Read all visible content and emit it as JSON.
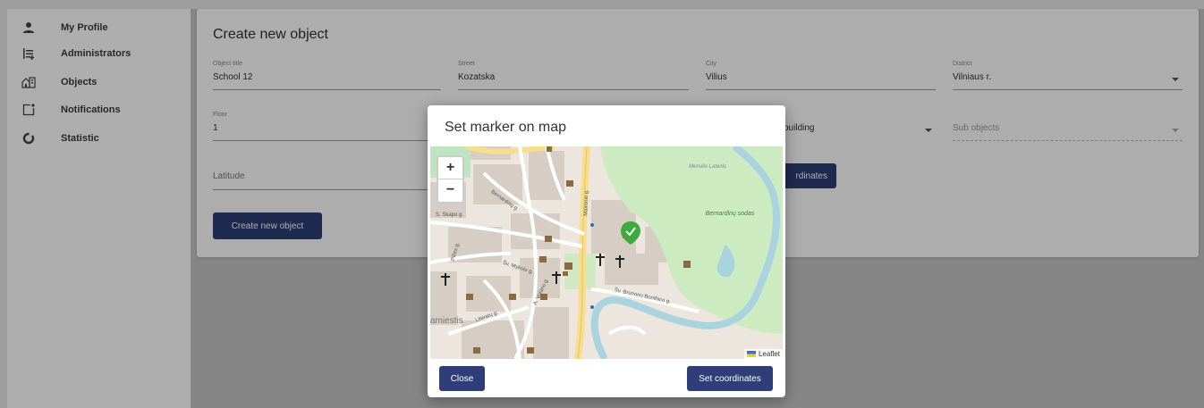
{
  "sidebar": {
    "items": [
      {
        "label": "My Profile",
        "icon": "person-icon"
      },
      {
        "label": "Administrators",
        "icon": "admin-list-icon"
      },
      {
        "label": "Objects",
        "icon": "buildings-icon"
      },
      {
        "label": "Notifications",
        "icon": "notification-icon"
      },
      {
        "label": "Statistic",
        "icon": "statistic-icon"
      }
    ]
  },
  "form": {
    "title": "Create new object",
    "object_title": {
      "label": "Object title",
      "value": "School 12"
    },
    "street": {
      "label": "Street",
      "value": "Kozatska"
    },
    "city": {
      "label": "City",
      "value": "Vilius"
    },
    "district": {
      "label": "District",
      "value": "Vilniaus r."
    },
    "floor": {
      "label": "Floor",
      "value": "1"
    },
    "building": {
      "value": "building"
    },
    "sub_objects": {
      "placeholder": "Sub objects"
    },
    "latitude": {
      "placeholder": "Latitude"
    },
    "set_coordinates_partial": "rdinates",
    "create_button": "Create new object"
  },
  "modal": {
    "title": "Set marker on map",
    "zoom_in": "+",
    "zoom_out": "−",
    "attribution": "Leaflet",
    "close_button": "Close",
    "set_coordinates_button": "Set coordinates",
    "map_labels": {
      "park": "Bernardinų sodas",
      "skapo": "S. Skapo g.",
      "mykolo": "Šv. Mykolo g.",
      "bernardinu": "Bernardinų g.",
      "maironio": "Maironio g.",
      "bonifaco": "Šv. Brunono Bonifaco g.",
      "literatu": "Literatų g.",
      "pilies": "Pilies g.",
      "vilniaus": "A. Volano g.",
      "senamiestis": "amiestis",
      "menulis": "Mėnulio Latenis"
    }
  },
  "colors": {
    "primary": "#2f3e78",
    "marker": "#3caa3c",
    "river": "#a9d3df",
    "park": "#cdebc0",
    "road": "#f8de8a"
  }
}
